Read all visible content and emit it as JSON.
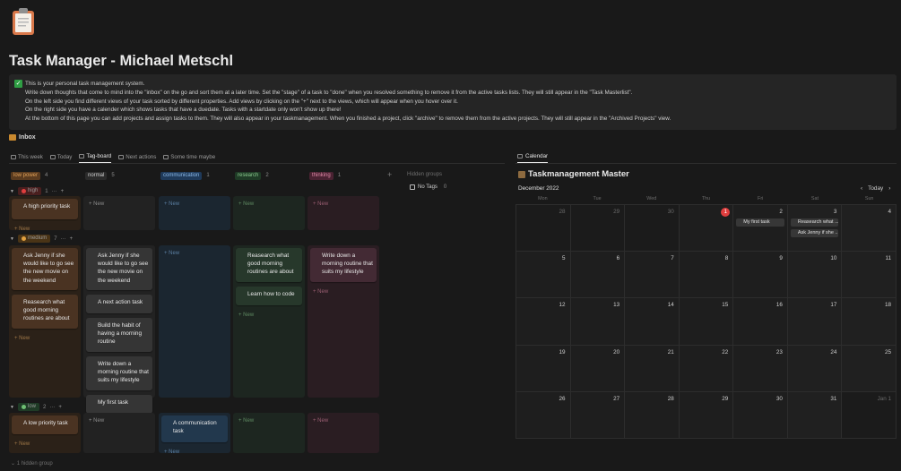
{
  "page": {
    "title": "Task Manager - Michael Metschl",
    "icon": "clipboard-icon"
  },
  "callout": {
    "icon": "check-mark-icon",
    "lines": [
      "This is your personal task management system.",
      "Write down thoughts that come to mind into the \"inbox\" on the go and sort them at a later time. Set the \"stage\" of a task to \"done\" when you resolved something to remove it from the active tasks lists. They will still appear in the \"Task Masterlist\".",
      "On the left side you find different views of your task sorted by different properties. Add views by clicking on the \"+\" next to the views, which will appear when you hover over it.",
      "On the right side you have a calender which shows tasks that have a duedate. Tasks with a startdate only won't show up there!",
      "At the bottom of this page you can add projects and assign tasks to them. They will also appear in your taskmanagement. When you finished a project, click \"archive\" to remove them from the active projects. They will still appear in the \"Archived Projects\" view."
    ]
  },
  "inbox": {
    "label": "Inbox",
    "icon": "inbox-icon"
  },
  "views": [
    {
      "label": "This week",
      "active": false
    },
    {
      "label": "Today",
      "active": false
    },
    {
      "label": "Tag-board",
      "active": true
    },
    {
      "label": "Next actions",
      "active": false
    },
    {
      "label": "Some time maybe",
      "active": false
    }
  ],
  "board": {
    "columns": [
      {
        "label": "low power",
        "count": "4",
        "bg": "#5a3b1f",
        "fg": "#e0a25a"
      },
      {
        "label": "normal",
        "count": "5",
        "bg": "#2b2b2b",
        "fg": "#cfcfcf"
      },
      {
        "label": "communication",
        "count": "1",
        "bg": "#1f3a5a",
        "fg": "#8cb9e6"
      },
      {
        "label": "research",
        "count": "2",
        "bg": "#1f3b26",
        "fg": "#8cc98f"
      },
      {
        "label": "thinking",
        "count": "1",
        "bg": "#4a2232",
        "fg": "#e08aa8"
      }
    ],
    "groups": [
      {
        "label": "high",
        "count": "1",
        "dot": "#e03e3e",
        "pill_bg": "#4a1f1f",
        "cells": [
          {
            "cards": [
              "A high priority task"
            ],
            "new": "New"
          },
          {
            "cards": [],
            "new": "New"
          },
          {
            "cards": [],
            "new": "New"
          },
          {
            "cards": [],
            "new": "New"
          },
          {
            "cards": [],
            "new": "New"
          }
        ]
      },
      {
        "label": "medium",
        "count": "7",
        "dot": "#e0a040",
        "pill_bg": "#4a3416",
        "cells": [
          {
            "cards": [
              "Ask Jenny if she would like to go see the new movie on the weekend",
              "Reasearch what good morning routines are about"
            ],
            "new": "New"
          },
          {
            "cards": [
              "Ask Jenny if she would like to go see the new movie on the weekend",
              "A next action task",
              "Build the habit of having a morning routine",
              "Write down a morning routine that suits my lifestyle",
              "My first task"
            ],
            "new": "New"
          },
          {
            "cards": [],
            "new": "New"
          },
          {
            "cards": [
              "Reasearch what good morning routines are about",
              "Learn how to code"
            ],
            "new": "New"
          },
          {
            "cards": [
              "Write down a morning routine that suits my lifestyle"
            ],
            "new": "New"
          }
        ]
      },
      {
        "label": "low",
        "count": "2",
        "dot": "#6fbf73",
        "pill_bg": "#1f3b26",
        "cells": [
          {
            "cards": [
              "A low priority task"
            ],
            "new": "New"
          },
          {
            "cards": [],
            "new": "New"
          },
          {
            "cards": [
              "A communication task"
            ],
            "new": "New"
          },
          {
            "cards": [],
            "new": "New"
          },
          {
            "cards": [],
            "new": "New"
          }
        ]
      }
    ],
    "hidden_groups_label": "Hidden groups",
    "no_tags_label": "No Tags",
    "no_tags_count": "0",
    "hidden_group_footer": "1 hidden group",
    "add_symbol": "+",
    "more_symbol": "···"
  },
  "calendar": {
    "tab_label": "Calendar",
    "title": "Taskmanagement Master",
    "month": "December 2022",
    "today_label": "Today",
    "prev": "‹",
    "next": "›",
    "weekdays": [
      "Mon",
      "Tue",
      "Wed",
      "Thu",
      "Fri",
      "Sat",
      "Sun"
    ],
    "days": [
      {
        "num": "28",
        "other": true
      },
      {
        "num": "29",
        "other": true
      },
      {
        "num": "30",
        "other": true
      },
      {
        "num": "1",
        "today": true
      },
      {
        "num": "2",
        "events": [
          "My first task"
        ]
      },
      {
        "num": "3",
        "events": [
          "Reasearch what ...",
          "Ask Jenny if she ..."
        ]
      },
      {
        "num": "4"
      },
      {
        "num": "5"
      },
      {
        "num": "6"
      },
      {
        "num": "7"
      },
      {
        "num": "8"
      },
      {
        "num": "9"
      },
      {
        "num": "10"
      },
      {
        "num": "11"
      },
      {
        "num": "12"
      },
      {
        "num": "13"
      },
      {
        "num": "14"
      },
      {
        "num": "15"
      },
      {
        "num": "16"
      },
      {
        "num": "17"
      },
      {
        "num": "18"
      },
      {
        "num": "19"
      },
      {
        "num": "20"
      },
      {
        "num": "21"
      },
      {
        "num": "22"
      },
      {
        "num": "23"
      },
      {
        "num": "24"
      },
      {
        "num": "25"
      },
      {
        "num": "26"
      },
      {
        "num": "27"
      },
      {
        "num": "28"
      },
      {
        "num": "29"
      },
      {
        "num": "30"
      },
      {
        "num": "31"
      },
      {
        "num": "Jan 1",
        "other": true
      }
    ]
  },
  "colors": {
    "low_power_cell": "#2b2118",
    "low_power_card": "#4a3322",
    "normal_cell": "#222222",
    "normal_card": "#353535",
    "communication_cell": "#1b2630",
    "communication_card": "#22384d",
    "research_cell": "#1d2620",
    "research_card": "#27382b",
    "thinking_cell": "#2a1d22",
    "thinking_card": "#432a34"
  }
}
